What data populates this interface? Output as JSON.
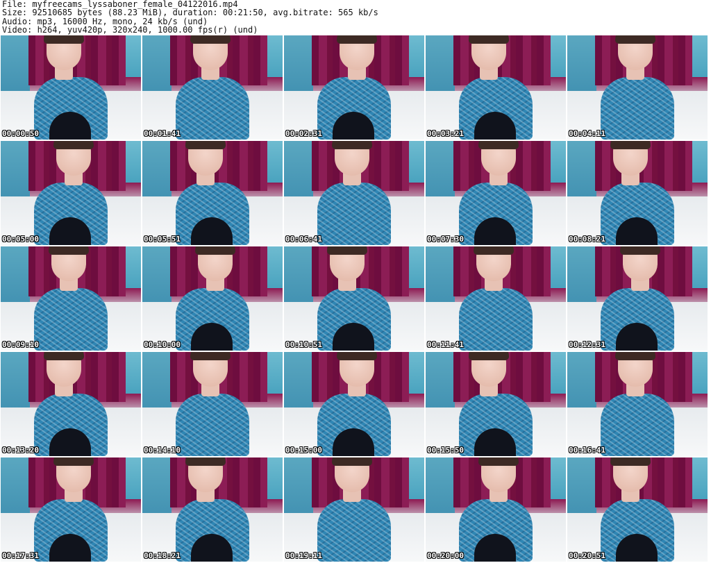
{
  "header": {
    "file_line": "File: myfreecams_lyssaboner_female_04122016.mp4",
    "size_line": "Size: 92510685 bytes (88.23 MiB), duration: 00:21:50, avg.bitrate: 565 kb/s",
    "audio_line": "Audio: mp3, 16000 Hz, mono, 24 kb/s (und)",
    "video_line": "Video: h264, yuv420p, 320x240, 1000.00 fps(r) (und)"
  },
  "thumbnails": [
    {
      "timestamp": "00:00:50"
    },
    {
      "timestamp": "00:01:41"
    },
    {
      "timestamp": "00:02:31"
    },
    {
      "timestamp": "00:03:21"
    },
    {
      "timestamp": "00:04:11"
    },
    {
      "timestamp": "00:05:00"
    },
    {
      "timestamp": "00:05:51"
    },
    {
      "timestamp": "00:06:41"
    },
    {
      "timestamp": "00:07:30"
    },
    {
      "timestamp": "00:08:21"
    },
    {
      "timestamp": "00:09:10"
    },
    {
      "timestamp": "00:10:00"
    },
    {
      "timestamp": "00:10:51"
    },
    {
      "timestamp": "00:11:41"
    },
    {
      "timestamp": "00:12:31"
    },
    {
      "timestamp": "00:13:20"
    },
    {
      "timestamp": "00:14:10"
    },
    {
      "timestamp": "00:15:00"
    },
    {
      "timestamp": "00:15:50"
    },
    {
      "timestamp": "00:16:41"
    },
    {
      "timestamp": "00:17:31"
    },
    {
      "timestamp": "00:18:21"
    },
    {
      "timestamp": "00:19:11"
    },
    {
      "timestamp": "00:20:00"
    },
    {
      "timestamp": "00:20:51"
    }
  ]
}
